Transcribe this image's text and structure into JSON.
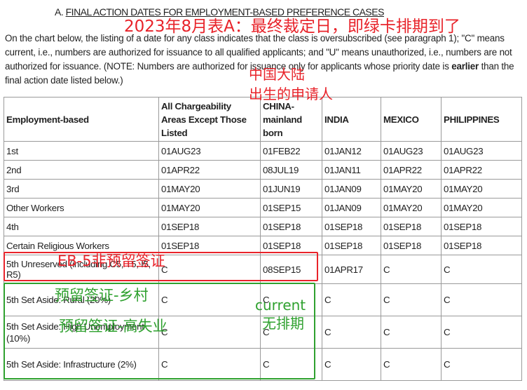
{
  "heading": {
    "prefix": "A.",
    "title": "FINAL ACTION DATES FOR EMPLOYMENT-BASED PREFERENCE CASES"
  },
  "intro": {
    "part1": "On the chart below, the listing of a date for any class indicates that the class is oversubscribed (see paragraph 1); \"C\" means current, i.e., numbers are authorized for issuance to all qualified applicants; and \"U\" means unauthorized, i.e., numbers are not authorized for issuance. (NOTE: Numbers are authorized for issuance only for applicants whose priority date is ",
    "bold": "earlier",
    "part2": " than the final action date listed below.)"
  },
  "table": {
    "headers": [
      "Employment-based",
      "All Chargeability Areas Except Those Listed",
      "CHINA-mainland born",
      "INDIA",
      "MEXICO",
      "PHILIPPINES"
    ],
    "rows": [
      [
        "1st",
        "01AUG23",
        "01FEB22",
        "01JAN12",
        "01AUG23",
        "01AUG23"
      ],
      [
        "2nd",
        "01APR22",
        "08JUL19",
        "01JAN11",
        "01APR22",
        "01APR22"
      ],
      [
        "3rd",
        "01MAY20",
        "01JUN19",
        "01JAN09",
        "01MAY20",
        "01MAY20"
      ],
      [
        "Other Workers",
        "01MAY20",
        "01SEP15",
        "01JAN09",
        "01MAY20",
        "01MAY20"
      ],
      [
        "4th",
        "01SEP18",
        "01SEP18",
        "01SEP18",
        "01SEP18",
        "01SEP18"
      ],
      [
        "Certain Religious Workers",
        "01SEP18",
        "01SEP18",
        "01SEP18",
        "01SEP18",
        "01SEP18"
      ],
      [
        "5th Unreserved (including C5, T5, I5, R5)",
        "C",
        "08SEP15",
        "01APR17",
        "C",
        "C"
      ],
      [
        "5th Set Aside: Rural (20%)",
        "C",
        "C",
        "C",
        "C",
        "C"
      ],
      [
        "5th Set Aside: High Unemployment (10%)",
        "C",
        "C",
        "C",
        "C",
        "C"
      ],
      [
        "5th Set Aside: Infrastructure (2%)",
        "C",
        "C",
        "C",
        "C",
        "C"
      ]
    ]
  },
  "annotations": {
    "title": "2023年8月表A：最终裁定日，即绿卡排期到了",
    "china_line1": "中国大陆",
    "china_line2": "出生的申请人",
    "eb5_unreserved": "EB-5非预留签证",
    "rural": "预留签证-乡村",
    "high_unemployment": "预留签证-高失业",
    "current": "current",
    "no_backlog": "无排期"
  },
  "colors": {
    "annotation_red": "#e8232a",
    "annotation_green": "#2fa12f",
    "grid": "#9a9a9a"
  }
}
